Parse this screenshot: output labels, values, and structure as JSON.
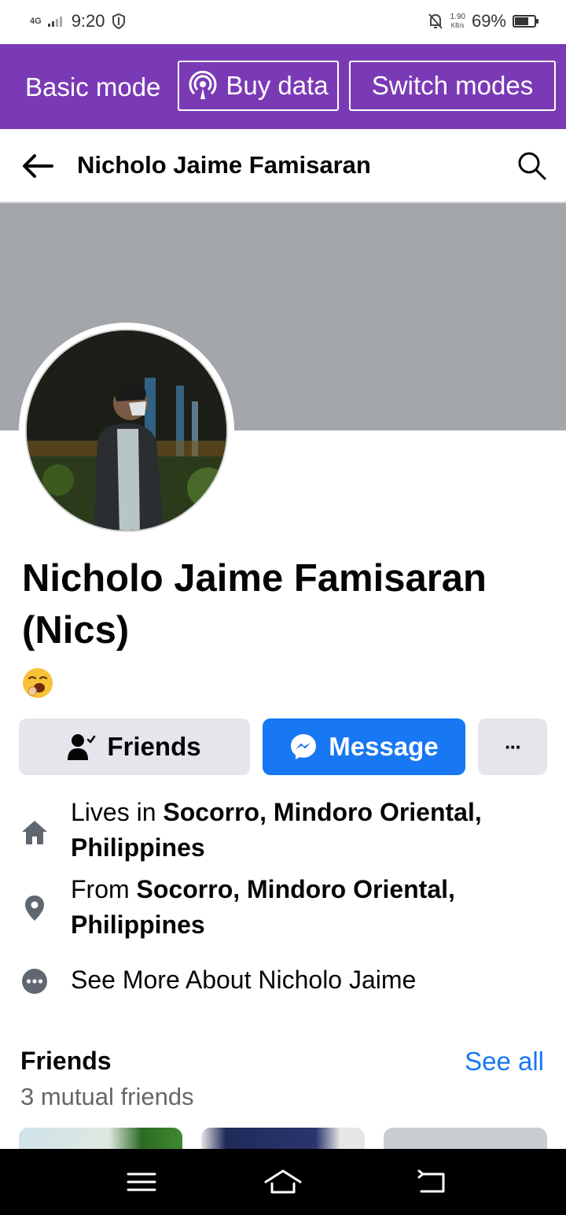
{
  "status_bar": {
    "network": "4G",
    "time": "9:20",
    "speed_value": "1.90",
    "speed_unit": "KB/s",
    "battery_percent": "69%",
    "battery_level": 0.69
  },
  "mode_bar": {
    "basic_label": "Basic mode",
    "buy_label": "Buy data",
    "switch_label": "Switch modes"
  },
  "header": {
    "title": "Nicholo Jaime Famisaran"
  },
  "profile": {
    "name": "Nicholo Jaime Famisaran (Nics)",
    "status_emoji": "yawning-face"
  },
  "actions": {
    "friends_label": "Friends",
    "message_label": "Message",
    "more_label": "···"
  },
  "intro": {
    "lives_prefix": "Lives in ",
    "lives_place": "Socorro, Mindoro Oriental, Philippines",
    "from_prefix": "From ",
    "from_place": "Socorro, Mindoro Oriental, Philippines",
    "see_more": "See More About Nicholo Jaime"
  },
  "friends": {
    "title": "Friends",
    "see_all": "See all",
    "mutual": "3 mutual friends"
  },
  "colors": {
    "mode_bar": "#7b3ab5",
    "accent": "#1877f2",
    "cover": "#a3a6aa"
  }
}
